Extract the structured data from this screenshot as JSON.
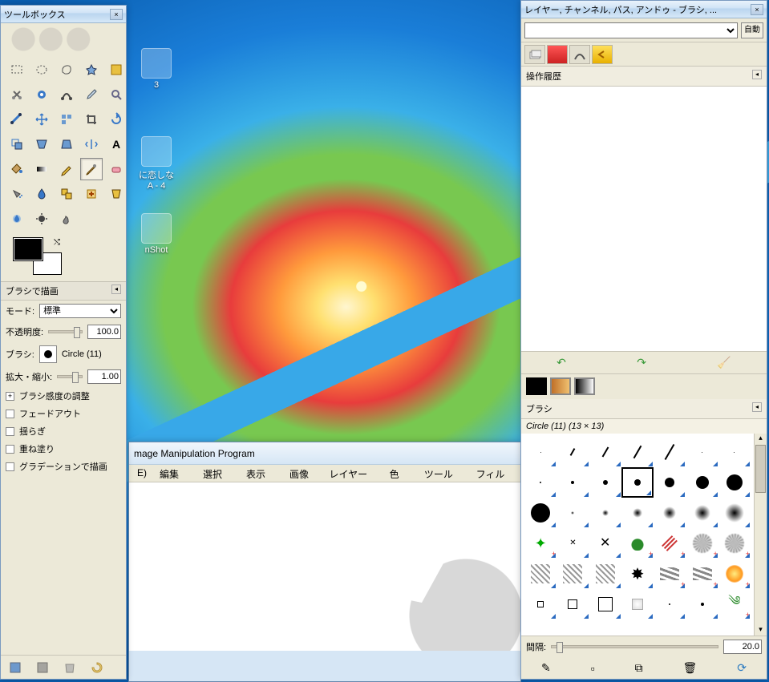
{
  "toolbox": {
    "title": "ツールボックス",
    "tools": [
      "rect-select",
      "ellipse-select",
      "free-select",
      "fuzzy-select",
      "by-color-select",
      "scissors",
      "foreground-select",
      "paths",
      "color-picker",
      "magnify",
      "measure",
      "move",
      "align",
      "crop",
      "rotate",
      "scale",
      "shear",
      "perspective",
      "flip",
      "text",
      "bucket-fill",
      "blend",
      "pencil",
      "paintbrush",
      "eraser",
      "airbrush",
      "ink",
      "clone",
      "heal",
      "perspective-clone",
      "blur",
      "dodge",
      "smudge"
    ],
    "active_tool": "paintbrush",
    "fgbg": {
      "fg": "#000000",
      "bg": "#ffffff"
    }
  },
  "tool_options": {
    "title": "ブラシで描画",
    "mode_label": "モード:",
    "mode_value": "標準",
    "opacity_label": "不透明度:",
    "opacity_value": "100.0",
    "brush_label": "ブラシ:",
    "brush_name": "Circle (11)",
    "scale_label": "拡大・縮小:",
    "scale_value": "1.00",
    "dynamics_label": "ブラシ感度の調整",
    "checks": [
      "フェードアウト",
      "揺らぎ",
      "重ね塗り",
      "グラデーションで描画"
    ]
  },
  "main_window": {
    "title_fragment": "mage Manipulation Program",
    "menus": [
      "E)",
      "編集(E)",
      "選択(S)",
      "表示(V)",
      "画像(I)",
      "レイヤー(L)",
      "色(C)",
      "ツール(T)",
      "フィルタ"
    ]
  },
  "dock": {
    "title": "レイヤー, チャンネル, パス, アンドゥ - ブラシ, ...",
    "auto_label": "自動",
    "history_title": "操作履歴",
    "brush_panel_title": "ブラシ",
    "brush_current": "Circle (11) (13 × 13)",
    "spacing_label": "間隔:",
    "spacing_value": "20.0"
  },
  "desktop": {
    "icons": [
      "3",
      "に恋しな",
      "A - 4",
      "nShot"
    ]
  }
}
